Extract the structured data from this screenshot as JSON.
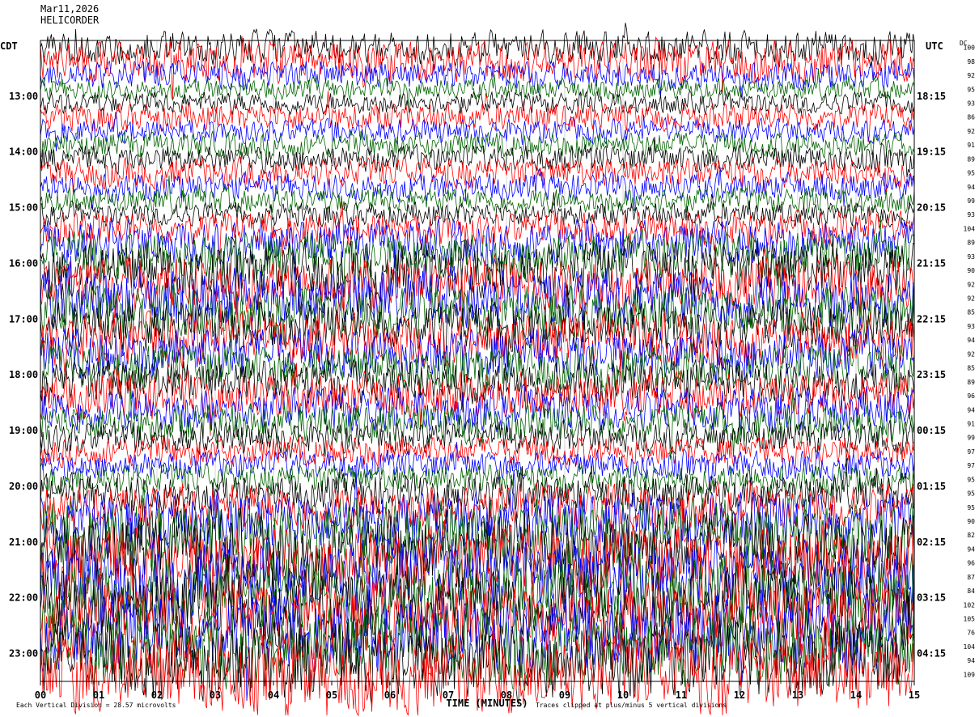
{
  "chart_data": {
    "type": "line",
    "title": "Mar11,2026",
    "subtitle": "HELICORDER",
    "left_axis_label": "CDT",
    "right_axis_label": "UTC",
    "dc_label": "DC",
    "left_time_labels": [
      "13:00",
      "14:00",
      "15:00",
      "16:00",
      "17:00",
      "18:00",
      "19:00",
      "20:00",
      "21:00",
      "22:00",
      "23:00"
    ],
    "right_time_labels": [
      "18:15",
      "19:15",
      "20:15",
      "21:15",
      "22:15",
      "23:15",
      "00:15",
      "01:15",
      "02:15",
      "03:15",
      "04:15"
    ],
    "dc_values": [
      "100",
      "98",
      "92",
      "95",
      "93",
      "86",
      "92",
      "91",
      "89",
      "95",
      "94",
      "99",
      "93",
      "104",
      "89",
      "93",
      "90",
      "92",
      "92",
      "85",
      "93",
      "94",
      "92",
      "85",
      "89",
      "96",
      "94",
      "91",
      "99",
      "97",
      "97",
      "95",
      "95",
      "95",
      "90",
      "82",
      "94",
      "96",
      "87",
      "84",
      "102",
      "105",
      "76",
      "104",
      "94",
      "109"
    ],
    "xlabel": "TIME (MINUTES)",
    "x_ticks": [
      "00",
      "01",
      "02",
      "03",
      "04",
      "05",
      "06",
      "07",
      "08",
      "09",
      "10",
      "11",
      "12",
      "13",
      "14",
      "15"
    ],
    "xlim": [
      0,
      15
    ],
    "footer_left": "Each Vertical Division = 28.57 microvolts",
    "footer_right": "Traces clipped at plus/minus 5 vertical divisions",
    "trace_colors": [
      "#000000",
      "#ff0000",
      "#0000ff",
      "#006400"
    ],
    "series": [
      {
        "index": 0,
        "amplitude": 0.42
      },
      {
        "index": 1,
        "amplitude": 0.52
      },
      {
        "index": 2,
        "amplitude": 0.36
      },
      {
        "index": 3,
        "amplitude": 0.26
      },
      {
        "index": 4,
        "amplitude": 0.28
      },
      {
        "index": 5,
        "amplitude": 0.35
      },
      {
        "index": 6,
        "amplitude": 0.3
      },
      {
        "index": 7,
        "amplitude": 0.32
      },
      {
        "index": 8,
        "amplitude": 0.34
      },
      {
        "index": 9,
        "amplitude": 0.38
      },
      {
        "index": 10,
        "amplitude": 0.35
      },
      {
        "index": 11,
        "amplitude": 0.32
      },
      {
        "index": 12,
        "amplitude": 0.3
      },
      {
        "index": 13,
        "amplitude": 0.42
      },
      {
        "index": 14,
        "amplitude": 0.55
      },
      {
        "index": 15,
        "amplitude": 0.62
      },
      {
        "index": 16,
        "amplitude": 0.72
      },
      {
        "index": 17,
        "amplitude": 0.7
      },
      {
        "index": 18,
        "amplitude": 0.75
      },
      {
        "index": 19,
        "amplitude": 0.68
      },
      {
        "index": 20,
        "amplitude": 0.62
      },
      {
        "index": 21,
        "amplitude": 0.66
      },
      {
        "index": 22,
        "amplitude": 0.64
      },
      {
        "index": 23,
        "amplitude": 0.58
      },
      {
        "index": 24,
        "amplitude": 0.55
      },
      {
        "index": 25,
        "amplitude": 0.58
      },
      {
        "index": 26,
        "amplitude": 0.55
      },
      {
        "index": 27,
        "amplitude": 0.5
      },
      {
        "index": 28,
        "amplitude": 0.4
      },
      {
        "index": 29,
        "amplitude": 0.38
      },
      {
        "index": 30,
        "amplitude": 0.36
      },
      {
        "index": 31,
        "amplitude": 0.38
      },
      {
        "index": 32,
        "amplitude": 0.48
      },
      {
        "index": 33,
        "amplitude": 0.58
      },
      {
        "index": 34,
        "amplitude": 0.75
      },
      {
        "index": 35,
        "amplitude": 0.88
      },
      {
        "index": 36,
        "amplitude": 0.95
      },
      {
        "index": 37,
        "amplitude": 0.98
      },
      {
        "index": 38,
        "amplitude": 0.95
      },
      {
        "index": 39,
        "amplitude": 0.92
      },
      {
        "index": 40,
        "amplitude": 0.95
      },
      {
        "index": 41,
        "amplitude": 0.98
      },
      {
        "index": 42,
        "amplitude": 0.95
      },
      {
        "index": 43,
        "amplitude": 1.0
      },
      {
        "index": 44,
        "amplitude": 1.0
      },
      {
        "index": 45,
        "amplitude": 1.0
      }
    ]
  }
}
